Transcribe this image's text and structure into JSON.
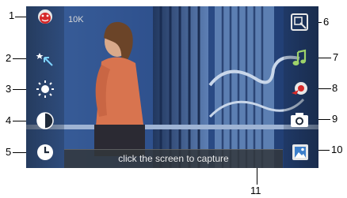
{
  "callouts": [
    "1",
    "2",
    "3",
    "4",
    "5",
    "6",
    "7",
    "8",
    "9",
    "10",
    "11"
  ],
  "overlay": {
    "resolution": "10K",
    "capture_hint": "click the screen to capture"
  },
  "icons": {
    "left": [
      "face-tracking-icon",
      "macro-focus-icon",
      "brightness-icon",
      "contrast-icon",
      "timer-icon"
    ],
    "right": [
      "zoom-icon",
      "shutter-sound-icon",
      "flash-mode-icon",
      "camera-switch-icon",
      "gallery-icon"
    ]
  },
  "colors": {
    "accent_red": "#d62a2a",
    "icon_white": "#ffffff"
  }
}
